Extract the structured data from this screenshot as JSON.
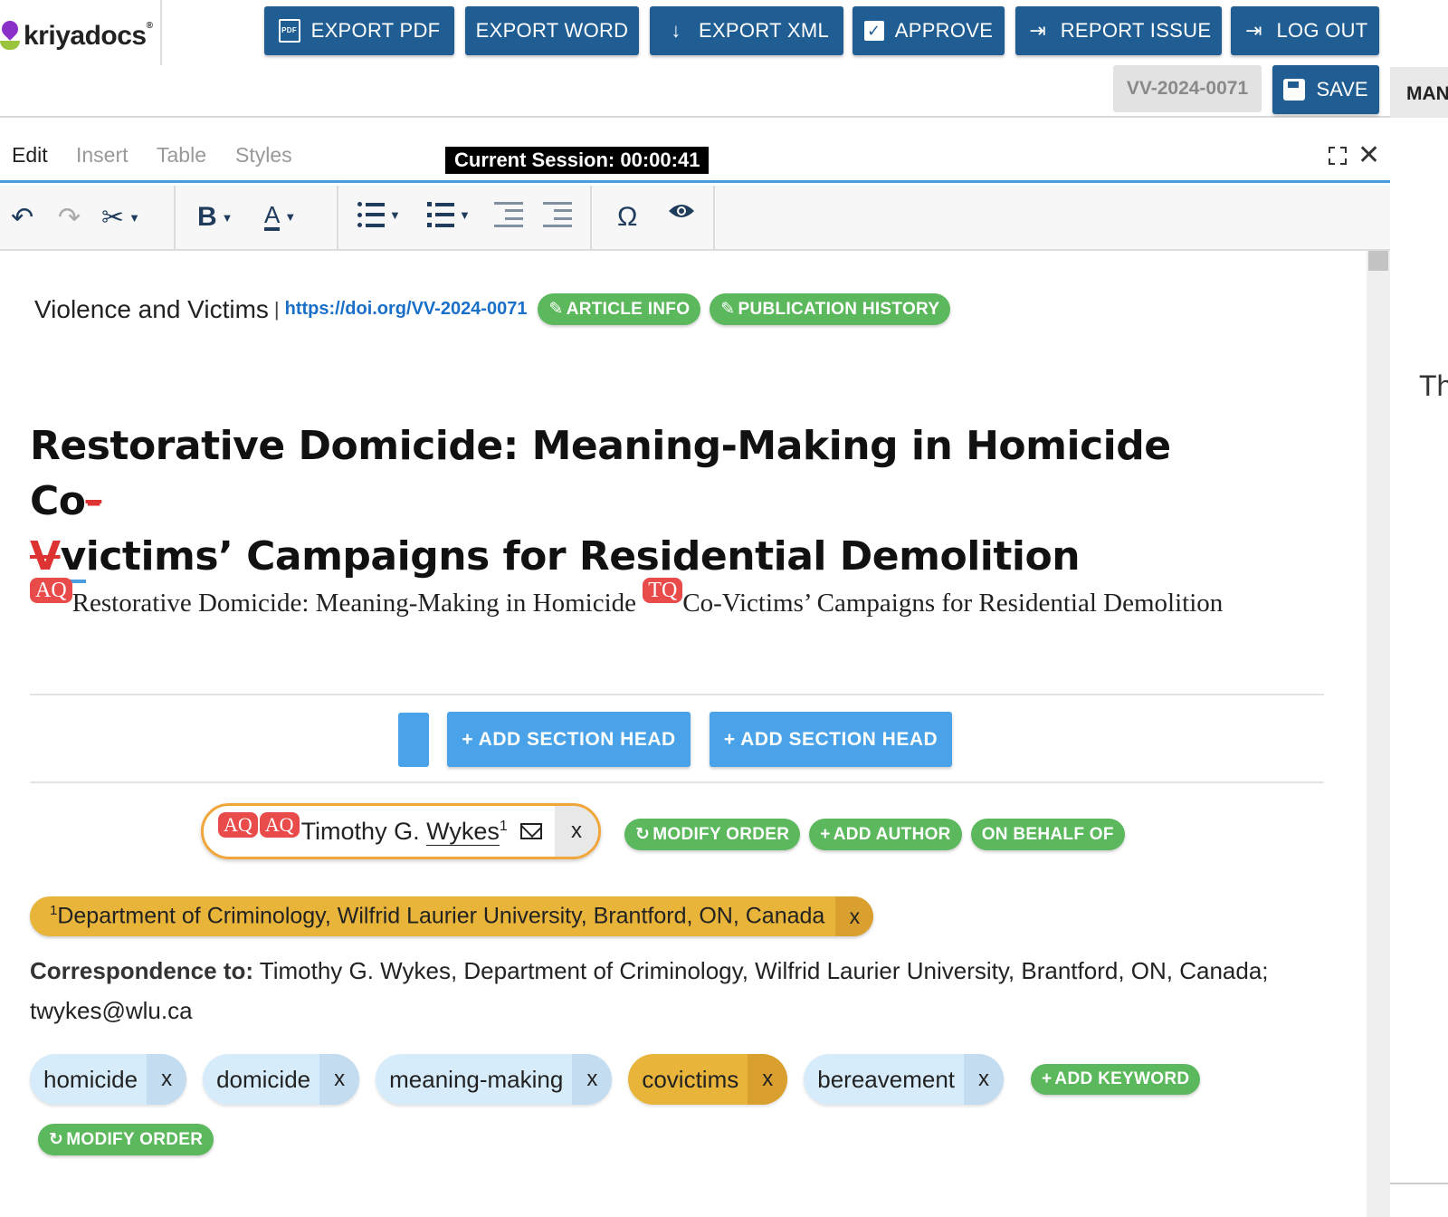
{
  "app": {
    "logo_text": "kriyadocs",
    "logo_reg": "®"
  },
  "header": {
    "buttons": {
      "export_pdf": "EXPORT PDF",
      "export_word": "EXPORT WORD",
      "export_xml": "EXPORT XML",
      "approve": "APPROVE",
      "report_issue": "REPORT ISSUE",
      "log_out": "LOG OUT"
    },
    "doc_id": "VV-2024-0071",
    "save": "SAVE",
    "right_tab": "MAN"
  },
  "menu": {
    "edit": "Edit",
    "insert": "Insert",
    "table": "Table",
    "styles": "Styles"
  },
  "session": "Current Session: 00:00:41",
  "toolbar": {
    "icons": [
      "undo-icon",
      "redo-icon",
      "cut-icon",
      "bold-icon",
      "font-color-icon",
      "bullet-list-icon",
      "numbered-list-icon",
      "indent-icon",
      "outdent-icon",
      "special-char-icon",
      "preview-icon"
    ],
    "bold_glyph": "B",
    "font_color_glyph": "A",
    "special_glyph": "Ω"
  },
  "article": {
    "journal": "Violence and Victims",
    "separator": "|",
    "doi": "https://doi.org/VV-2024-0071",
    "article_info": "ARTICLE INFO",
    "publication_history": "PUBLICATION HISTORY",
    "title_part1": "Restorative Domicide: Meaning-Making in Homicide Co",
    "title_deleted_hyphen": "-",
    "title_deleted_v": "V",
    "title_inserted": "v",
    "title_part2": "ictims’ Campaigns for Residential Demolition",
    "subtitle_tag1": "AQ",
    "subtitle_part1": "Restorative Domicide: Meaning-Making in Homicide ",
    "subtitle_tag2": "TQ",
    "subtitle_part2": "Co-Victims’ Campaigns for Residential Demolition"
  },
  "sections": {
    "add_section_head_1": "+ ADD SECTION HEAD",
    "add_section_head_2": "+ ADD SECTION HEAD"
  },
  "author": {
    "tag1": "AQ",
    "tag2": "AQ",
    "first": "Timothy G. ",
    "last": "Wykes",
    "sup": "1",
    "remove": "x",
    "modify_order": "MODIFY ORDER",
    "add_author": "ADD AUTHOR",
    "on_behalf_of": "ON BEHALF OF"
  },
  "affiliation": {
    "sup": "1",
    "text": "Department of Criminology, Wilfrid Laurier University, Brantford, ON, Canada",
    "remove": "x"
  },
  "correspondence": {
    "label": "Correspondence to:",
    "text": " Timothy G. Wykes, Department of Criminology, Wilfrid Laurier University, Brantford, ON, Canada; twykes@wlu.ca"
  },
  "keywords": {
    "items": [
      {
        "label": "homicide",
        "remove": "x"
      },
      {
        "label": "domicide",
        "remove": "x"
      },
      {
        "label": "meaning-making",
        "remove": "x"
      },
      {
        "label": "covictims",
        "remove": "x"
      },
      {
        "label": "bereavement",
        "remove": "x"
      }
    ],
    "add_keyword": "ADD KEYWORD",
    "modify_order": "MODIFY ORDER"
  },
  "right_pane": {
    "text": "Th"
  },
  "colors": {
    "primary": "#1f5d93",
    "accent_blue": "#4aa3e8",
    "green": "#5cb85c",
    "query_red": "#e94b4b",
    "highlight": "#e8b53a"
  }
}
